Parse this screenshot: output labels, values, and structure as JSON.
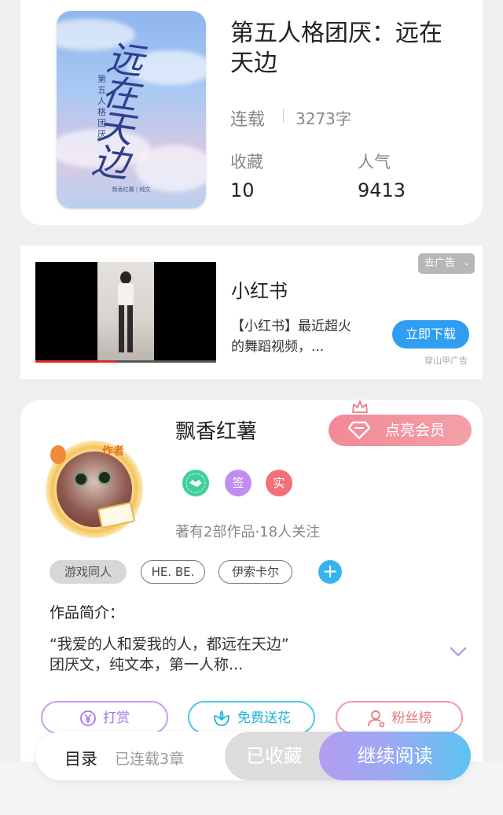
{
  "book": {
    "title": "第五人格团厌：远在天边",
    "status": "连载",
    "word_count": "3273字",
    "favorites_label": "收藏",
    "favorites_value": "10",
    "popularity_label": "人气",
    "popularity_value": "9413",
    "cover_calligraphy": "远在天边",
    "cover_subtitle": "第五人格团厌",
    "cover_author": "飘香红薯 | 纯文"
  },
  "ad": {
    "title": "小红书",
    "description": "【小红书】最近超火的舞蹈视频，...",
    "download_label": "立即下载",
    "close_label": "去广告",
    "source": "穿山甲广告",
    "progress_fraction": 0.45
  },
  "author": {
    "name": "飘香红薯",
    "vip_label": "点亮会员",
    "avatar_tag": "作者",
    "badges": [
      {
        "icon": "handshake-icon",
        "text": "",
        "color": "#3ecf9a"
      },
      {
        "icon": "sign-badge",
        "text": "签",
        "color": "#c08df0"
      },
      {
        "icon": "verified-badge",
        "text": "实",
        "color": "#f1707a"
      }
    ],
    "meta": "著有2部作品·18人关注",
    "tags": [
      "游戏同人",
      "HE. BE.",
      "伊索卡尔"
    ]
  },
  "intro": {
    "title": "作品简介：",
    "line1": "“我爱的人和爱我的人，都远在天边”",
    "line2": "团厌文，纯文本，第一人称..."
  },
  "actions": {
    "tip": "打赏",
    "flower": "免费送花",
    "fans": "粉丝榜"
  },
  "bottom": {
    "toc": "目录",
    "chapter_count": "已连载3章",
    "collected": "已收藏",
    "continue": "继续阅读"
  }
}
